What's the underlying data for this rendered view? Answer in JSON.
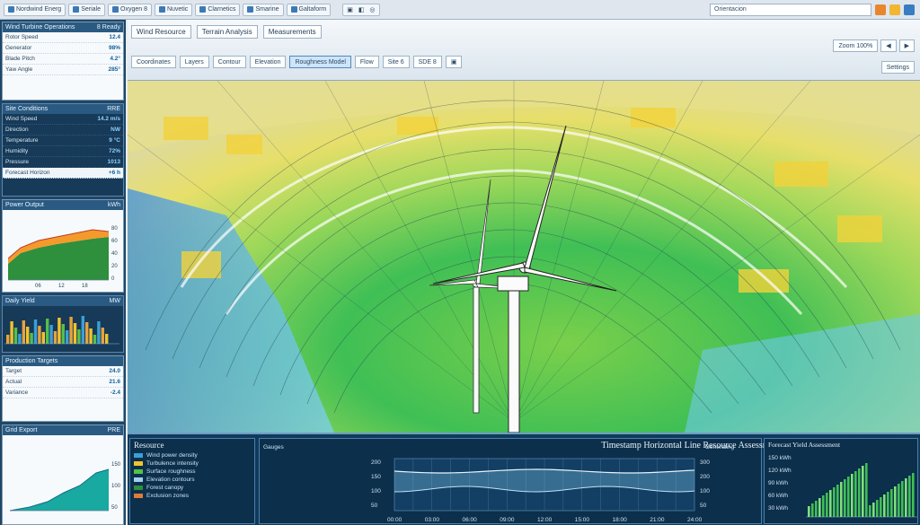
{
  "topbar": {
    "tabs": [
      "Nordwind Energ",
      "Seriale",
      "Oxygen 8",
      "Nuvetic",
      "Clarnetics",
      "Smarine",
      "Galtaform"
    ],
    "url": "Orientacion",
    "controls": [
      "▣",
      "◧",
      "◎"
    ]
  },
  "left": {
    "panel1": {
      "title": "Wind Turbine Operations",
      "count": "8 Ready",
      "rows": [
        {
          "k": "Rotor Speed",
          "v": "12.4"
        },
        {
          "k": "Generator",
          "v": "98%"
        },
        {
          "k": "Blade Pitch",
          "v": "4.2°"
        },
        {
          "k": "Yaw Angle",
          "v": "285°"
        }
      ]
    },
    "panel2": {
      "title": "Site Conditions",
      "badge": "RRE",
      "rows": [
        {
          "k": "Wind Speed",
          "v": "14.2 m/s"
        },
        {
          "k": "Direction",
          "v": "NW"
        },
        {
          "k": "Temperature",
          "v": "9 °C"
        },
        {
          "k": "Humidity",
          "v": "72%"
        },
        {
          "k": "Pressure",
          "v": "1013"
        }
      ],
      "footer_k": "Forecast Horizon",
      "footer_v": "+6 h"
    },
    "panel3": {
      "title": "Power Output",
      "badge": "kWh",
      "yticks": [
        "80",
        "60",
        "40",
        "20",
        "0"
      ],
      "xticks": [
        "06",
        "12",
        "18"
      ]
    },
    "panel4": {
      "title": "Daily Yield",
      "badge": "MW"
    },
    "panel5": {
      "title": "Production Targets",
      "rows": [
        {
          "k": "Target",
          "v": "24.0"
        },
        {
          "k": "Actual",
          "v": "21.6"
        },
        {
          "k": "Variance",
          "v": "-2.4"
        }
      ]
    },
    "panel6": {
      "title": "Grid Export",
      "badge": "PRE",
      "yticks": [
        "150",
        "100",
        "50"
      ]
    }
  },
  "ribbon": {
    "title": "Wind Resource",
    "subtitle": "Terrain Analysis",
    "menu": "Measurements",
    "tools": [
      "Coordinates",
      "Layers",
      "Contour",
      "Elevation",
      "Roughness Model",
      "Flow",
      "Site 6",
      "SDE 8",
      "▣"
    ],
    "right": [
      "Zoom 100%",
      "◀",
      "▶"
    ],
    "right_small": "Settings"
  },
  "bottom": {
    "legend_title": "Resource",
    "legend": [
      {
        "label": "Wind power density",
        "color": "#3aa0d8"
      },
      {
        "label": "Turbulence intensity",
        "color": "#f2c230"
      },
      {
        "label": "Surface roughness",
        "color": "#55c04a"
      },
      {
        "label": "Elevation contours",
        "color": "#9fd0ee"
      },
      {
        "label": "Forest canopy",
        "color": "#2f8f3a"
      },
      {
        "label": "Exclusion zones",
        "color": "#e07b39"
      }
    ],
    "center_title": "Timestamp Horizontal Line Resource Assessment",
    "center_left": "Gauges",
    "center_right": "Generating",
    "yleft": [
      "200",
      "150",
      "100",
      "50"
    ],
    "yright": [
      "300",
      "200",
      "100",
      "50"
    ],
    "xticks": [
      "00:00",
      "03:00",
      "06:00",
      "09:00",
      "12:00",
      "15:00",
      "18:00",
      "21:00",
      "24:00"
    ],
    "right_title": "Forecast Yield Assessment",
    "right_yticks": [
      "150 kWh",
      "120 kWh",
      "90 kWh",
      "60 kWh",
      "30 kWh"
    ]
  }
}
